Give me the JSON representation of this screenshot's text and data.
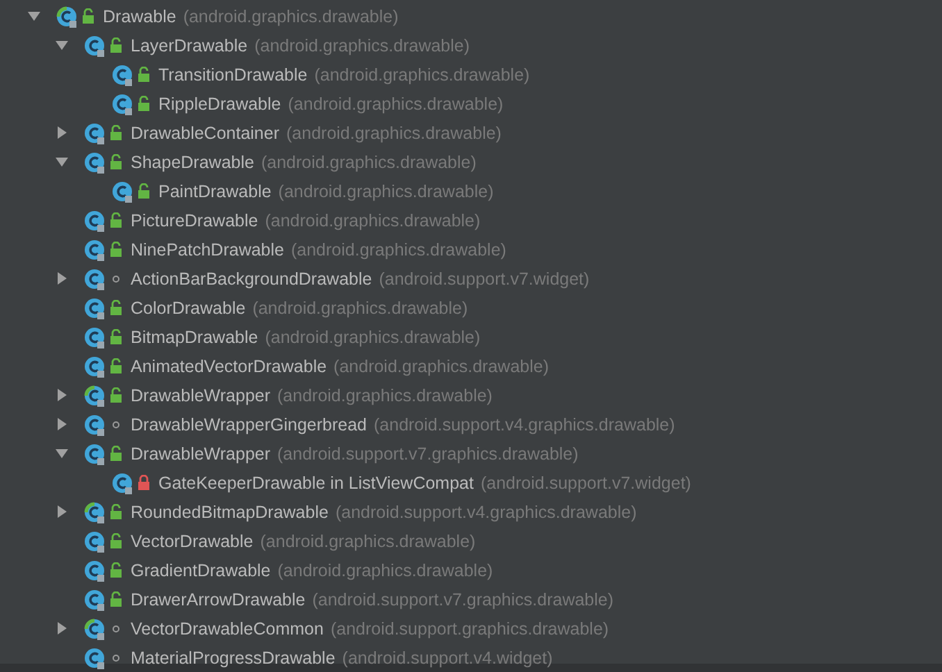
{
  "tree": [
    {
      "name": "Drawable",
      "package": "(android.graphics.drawable)",
      "kind": "abstract_class",
      "private": false,
      "package_private": false,
      "expanded": true,
      "children": [
        {
          "name": "LayerDrawable",
          "package": "(android.graphics.drawable)",
          "kind": "class",
          "private": false,
          "package_private": false,
          "expanded": true,
          "children": [
            {
              "name": "TransitionDrawable",
              "package": "(android.graphics.drawable)",
              "kind": "class",
              "private": false,
              "package_private": false
            },
            {
              "name": "RippleDrawable",
              "package": "(android.graphics.drawable)",
              "kind": "class",
              "private": false,
              "package_private": false
            }
          ]
        },
        {
          "name": "DrawableContainer",
          "package": "(android.graphics.drawable)",
          "kind": "class",
          "private": false,
          "package_private": false,
          "expanded": false
        },
        {
          "name": "ShapeDrawable",
          "package": "(android.graphics.drawable)",
          "kind": "class",
          "private": false,
          "package_private": false,
          "expanded": true,
          "children": [
            {
              "name": "PaintDrawable",
              "package": "(android.graphics.drawable)",
              "kind": "class",
              "private": false,
              "package_private": false
            }
          ]
        },
        {
          "name": "PictureDrawable",
          "package": "(android.graphics.drawable)",
          "kind": "class",
          "private": false,
          "package_private": false
        },
        {
          "name": "NinePatchDrawable",
          "package": "(android.graphics.drawable)",
          "kind": "class",
          "private": false,
          "package_private": false
        },
        {
          "name": "ActionBarBackgroundDrawable",
          "package": "(android.support.v7.widget)",
          "kind": "class",
          "private": false,
          "package_private": true,
          "expanded": false
        },
        {
          "name": "ColorDrawable",
          "package": "(android.graphics.drawable)",
          "kind": "class",
          "private": false,
          "package_private": false
        },
        {
          "name": "BitmapDrawable",
          "package": "(android.graphics.drawable)",
          "kind": "class",
          "private": false,
          "package_private": false
        },
        {
          "name": "AnimatedVectorDrawable",
          "package": "(android.graphics.drawable)",
          "kind": "class",
          "private": false,
          "package_private": false
        },
        {
          "name": "DrawableWrapper",
          "package": "(android.graphics.drawable)",
          "kind": "abstract_class",
          "private": false,
          "package_private": false,
          "expanded": false
        },
        {
          "name": "DrawableWrapperGingerbread",
          "package": "(android.support.v4.graphics.drawable)",
          "kind": "class",
          "private": false,
          "package_private": true,
          "expanded": false
        },
        {
          "name": "DrawableWrapper",
          "package": "(android.support.v7.graphics.drawable)",
          "kind": "class",
          "private": false,
          "package_private": false,
          "expanded": true,
          "children": [
            {
              "name": "GateKeeperDrawable in ListViewCompat",
              "package": "(android.support.v7.widget)",
              "kind": "class",
              "private": true
            }
          ]
        },
        {
          "name": "RoundedBitmapDrawable",
          "package": "(android.support.v4.graphics.drawable)",
          "kind": "abstract_class",
          "private": false,
          "package_private": false,
          "expanded": false
        },
        {
          "name": "VectorDrawable",
          "package": "(android.graphics.drawable)",
          "kind": "class",
          "private": false,
          "package_private": false
        },
        {
          "name": "GradientDrawable",
          "package": "(android.graphics.drawable)",
          "kind": "class",
          "private": false,
          "package_private": false
        },
        {
          "name": "DrawerArrowDrawable",
          "package": "(android.support.v7.graphics.drawable)",
          "kind": "class",
          "private": false,
          "package_private": false
        },
        {
          "name": "VectorDrawableCommon",
          "package": "(android.support.graphics.drawable)",
          "kind": "abstract_class",
          "private": false,
          "package_private": true,
          "expanded": false
        },
        {
          "name": "MaterialProgressDrawable",
          "package": "(android.support.v4.widget)",
          "kind": "class",
          "private": false,
          "package_private": true
        }
      ]
    }
  ]
}
